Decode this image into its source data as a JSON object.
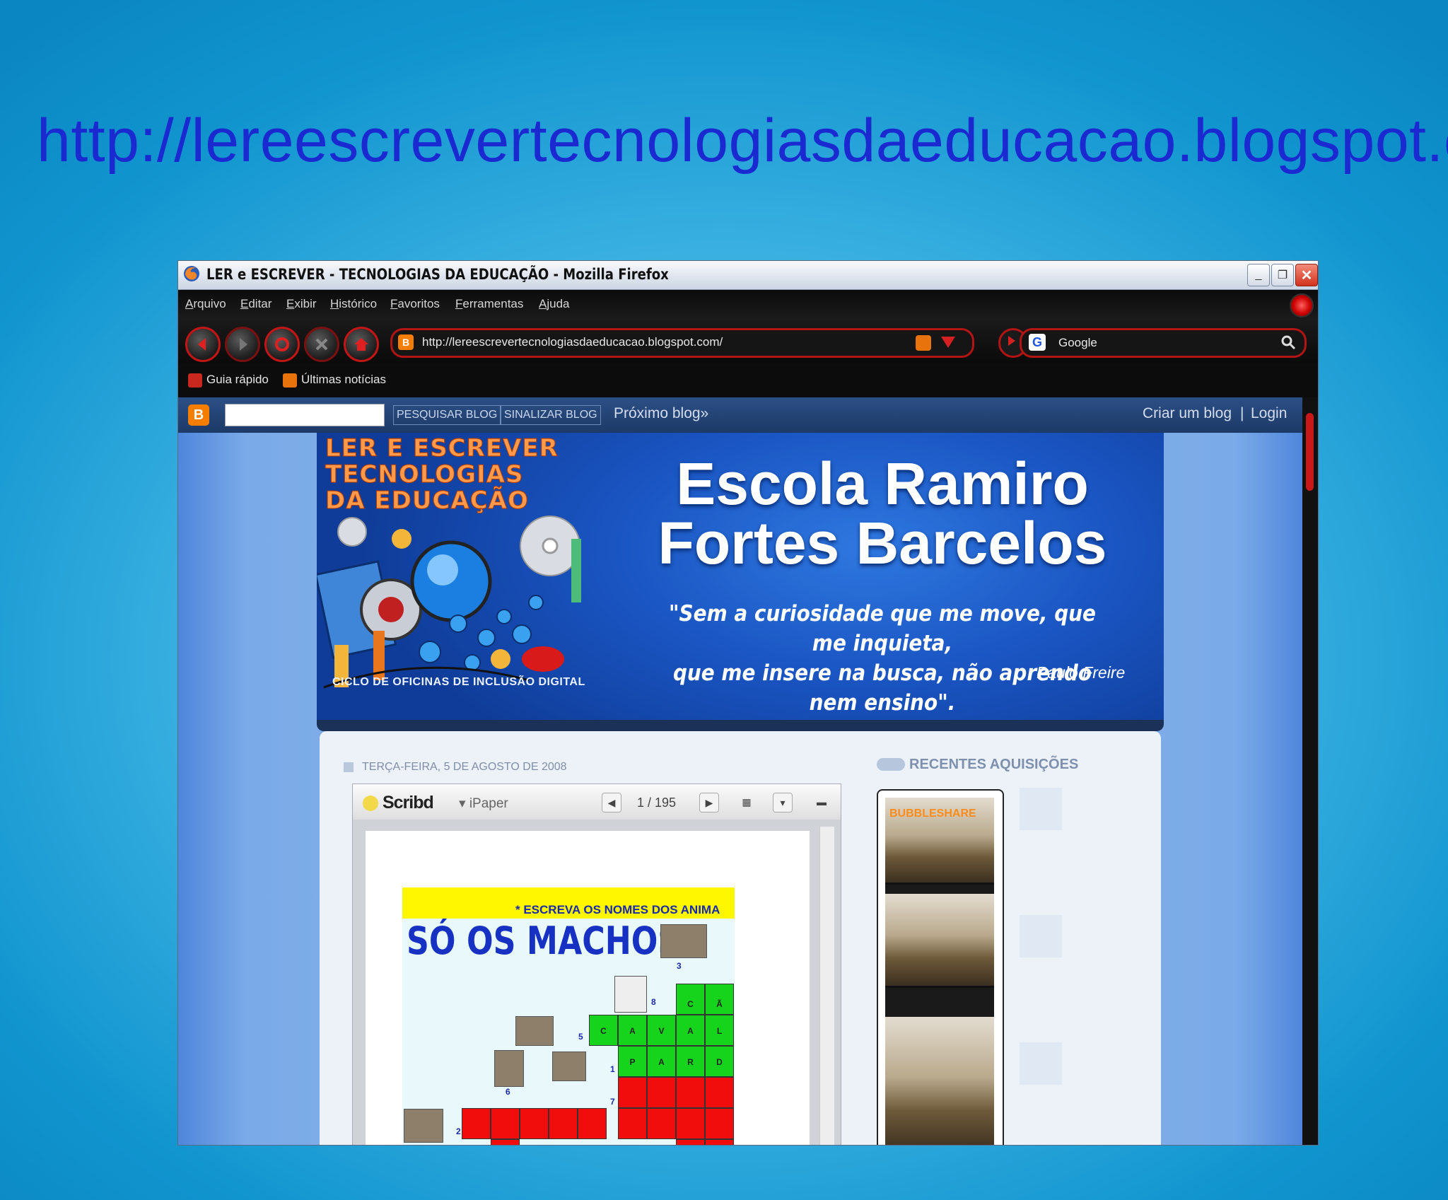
{
  "slide": {
    "url_heading": "http://lereescrevertecnologiasdaeducacao.blogspot.com"
  },
  "window": {
    "title": "LER e ESCREVER - TECNOLOGIAS DA EDUCAÇÃO - Mozilla Firefox"
  },
  "menu": [
    "Arquivo",
    "Editar",
    "Exibir",
    "Histórico",
    "Favoritos",
    "Ferramentas",
    "Ajuda"
  ],
  "navigation": {
    "address": "http://lereescrevertecnologiasdaeducacao.blogspot.com/",
    "search_engine": "Google"
  },
  "bookmarks": [
    "Guia rápido",
    "Últimas notícias"
  ],
  "blogger_bar": {
    "search_button": "PESQUISAR BLOG",
    "flag_button": "SINALIZAR BLOG",
    "next_blog": "Próximo blog»",
    "create_blog": "Criar um blog",
    "separator": "|",
    "login": "Login"
  },
  "blog_header": {
    "logo_lines": [
      "LER E ESCREVER",
      "TECNOLOGIAS",
      "DA EDUCAÇÃO"
    ],
    "caption": "CICLO DE OFICINAS DE INCLUSÃO DIGITAL",
    "title_line1": "Escola Ramiro",
    "title_line2": "Fortes Barcelos",
    "quote_line1": "\"Sem a curiosidade que me move, que me inquieta,",
    "quote_line2": "que me insere na busca, não aprendo nem ensino\".",
    "quote_author": "Paulo Freire"
  },
  "post": {
    "date": "TERÇA-FEIRA, 5 DE AGOSTO DE 2008",
    "scribd": {
      "brand": "Scribd",
      "mode": "iPaper",
      "page_indicator": "1 / 195",
      "doc_instruction": "* ESCREVA OS NOMES DOS ANIMA",
      "doc_title": "SÓ OS MACHOS!",
      "grid_letters": {
        "row1": [
          "C",
          "Ã"
        ],
        "row2": [
          "C",
          "A",
          "V",
          "A",
          "L"
        ],
        "row3": [
          "P",
          "A",
          "R",
          "D"
        ]
      },
      "clue_numbers": [
        "3",
        "8",
        "5",
        "1",
        "6",
        "7",
        "2"
      ]
    }
  },
  "sidebar": {
    "title": "RECENTES AQUISIÇÕES",
    "widget_brand": "BUBBLESHARE"
  },
  "colors": {
    "slide_url": "#1a2ad0",
    "browser_accent": "#b31414",
    "blogger_orange": "#f57d00"
  }
}
